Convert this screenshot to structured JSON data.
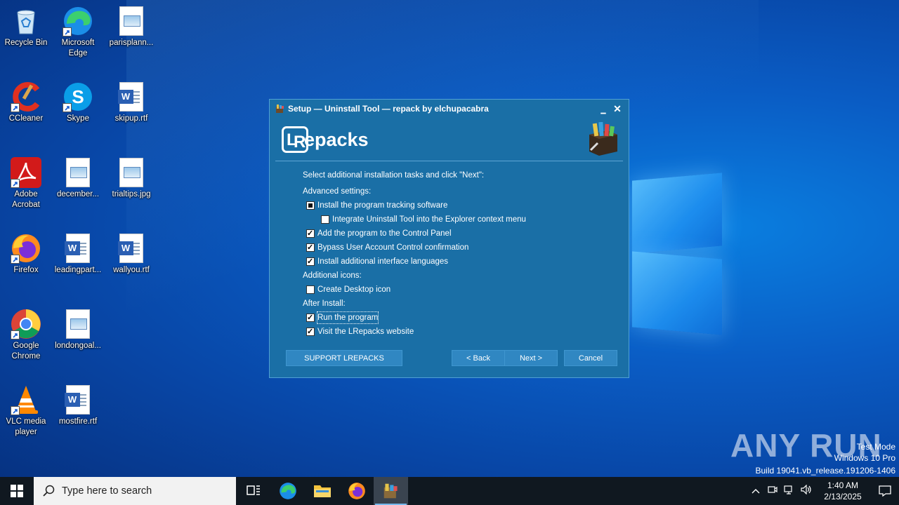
{
  "desktop": {
    "icons": [
      {
        "label": "Recycle Bin",
        "icon": "recycle-bin-icon"
      },
      {
        "label": "Microsoft Edge",
        "icon": "edge-icon"
      },
      {
        "label": "parisplann...",
        "icon": "image-file-icon"
      },
      {
        "label": "CCleaner",
        "icon": "ccleaner-icon"
      },
      {
        "label": "Skype",
        "icon": "skype-icon"
      },
      {
        "label": "skipup.rtf",
        "icon": "word-doc-icon"
      },
      {
        "label": "Adobe Acrobat",
        "icon": "acrobat-icon"
      },
      {
        "label": "december...",
        "icon": "image-file-icon"
      },
      {
        "label": "trialtips.jpg",
        "icon": "image-file-icon"
      },
      {
        "label": "Firefox",
        "icon": "firefox-icon"
      },
      {
        "label": "leadingpart...",
        "icon": "word-doc-icon"
      },
      {
        "label": "wallyou.rtf",
        "icon": "word-doc-icon"
      },
      {
        "label": "Google Chrome",
        "icon": "chrome-icon"
      },
      {
        "label": "londongoal...",
        "icon": "image-file-icon"
      },
      {
        "label": "VLC media player",
        "icon": "vlc-icon"
      },
      {
        "label": "mostfire.rtf",
        "icon": "word-doc-icon"
      }
    ]
  },
  "dialog": {
    "title": "Setup — Uninstall Tool — repack by elchupacabra",
    "brand_letter_l": "L",
    "brand_letter_r": "R",
    "brand_word": "epacks",
    "instruction": "Select additional installation tasks and click \"Next\":",
    "advanced_header": "Advanced settings:",
    "tasks": [
      {
        "label": "Install the program tracking software",
        "state": "mixed"
      },
      {
        "label": "Integrate Uninstall Tool into the Explorer context menu",
        "state": "unchecked"
      },
      {
        "label": "Add the program to the Control Panel",
        "state": "checked"
      },
      {
        "label": "Bypass User Account Control confirmation",
        "state": "checked"
      },
      {
        "label": "Install additional interface languages",
        "state": "checked"
      }
    ],
    "icons_header": "Additional icons:",
    "desktop_icon": {
      "label": "Create Desktop icon",
      "state": "unchecked"
    },
    "after_header": "After Install:",
    "after_tasks": [
      {
        "label": "Run the program",
        "state": "checked"
      },
      {
        "label": "Visit the LRepacks website",
        "state": "checked"
      }
    ],
    "buttons": {
      "support": "SUPPORT LREPACKS",
      "back": "< Back",
      "next": "Next >",
      "cancel": "Cancel"
    },
    "minimize": "▁",
    "close": "✕"
  },
  "watermark": {
    "brand": "ANY  RUN",
    "test_mode": "Test Mode",
    "os": "Windows 10 Pro",
    "build": "Build 19041.vb_release.191206-1406"
  },
  "taskbar": {
    "search_placeholder": "Type here to search",
    "time": "1:40 AM",
    "date": "2/13/2025"
  }
}
